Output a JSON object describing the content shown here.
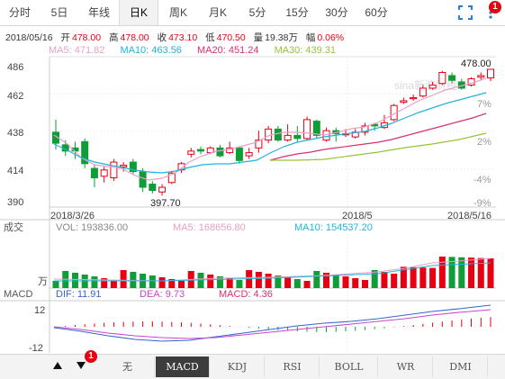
{
  "tabs": [
    {
      "label": "分时"
    },
    {
      "label": "5日"
    },
    {
      "label": "年线"
    },
    {
      "label": "日K"
    },
    {
      "label": "周K"
    },
    {
      "label": "月K"
    },
    {
      "label": "5分"
    },
    {
      "label": "15分"
    },
    {
      "label": "30分"
    },
    {
      "label": "60分"
    }
  ],
  "notification_count": "1",
  "quote": {
    "date": "2018/05/16",
    "open_label": "开",
    "open": "478.00",
    "high_label": "高",
    "high": "478.00",
    "close_label": "收",
    "close": "473.10",
    "low_label": "低",
    "low": "470.50",
    "vol_label": "量",
    "vol": "19.38万",
    "amp_label": "幅",
    "amp": "0.06%"
  },
  "ma": {
    "ma5": "MA5: 471.82",
    "ma10": "MA10: 463.56",
    "ma20": "MA20: 451.24",
    "ma30": "MA30: 439.31"
  },
  "watermark": "sina新浪财经",
  "price_axis": [
    "486",
    "462",
    "438",
    "414",
    "390"
  ],
  "pct_axis": [
    "7%",
    "2%",
    "-4%",
    "-9%"
  ],
  "date_axis": [
    "2018/3/26",
    "2018/5",
    "2018/5/16"
  ],
  "price_high_label": "478.00",
  "price_low_label": "397.70",
  "volume": {
    "title": "成交",
    "vol": "VOL: 193836.00",
    "ma5": "MA5: 168656.80",
    "ma10": "MA10: 154537.20",
    "unit": "万"
  },
  "macd": {
    "title": "MACD",
    "dif": "DIF: 11.91",
    "dea": "DEA: 9.73",
    "macd": "MACD: 4.36",
    "axis_top": "12",
    "axis_bottom": "-12"
  },
  "bottom_tabs": [
    "无",
    "MACD",
    "KDJ",
    "RSI",
    "BOLL",
    "WR",
    "DMI"
  ],
  "bottom_badge": "1",
  "colors": {
    "up": "#e60012",
    "down": "#0f9d37",
    "ma5": "#e8a0c8",
    "ma10": "#23b3d9",
    "ma20": "#d93070",
    "ma30": "#99c23a",
    "dif": "#3366cc",
    "dea": "#cc44cc"
  },
  "chart_data": {
    "type": "candlestick",
    "ylim": [
      390,
      486
    ],
    "candles": [
      {
        "o": 438,
        "c": 431,
        "h": 446,
        "l": 427
      },
      {
        "o": 430,
        "c": 426,
        "h": 433,
        "l": 423
      },
      {
        "o": 428,
        "c": 426,
        "h": 432,
        "l": 421
      },
      {
        "o": 432,
        "c": 418,
        "h": 434,
        "l": 415
      },
      {
        "o": 415,
        "c": 409,
        "h": 417,
        "l": 403
      },
      {
        "o": 410,
        "c": 414,
        "h": 416,
        "l": 406
      },
      {
        "o": 409,
        "c": 419,
        "h": 421,
        "l": 407
      },
      {
        "o": 416,
        "c": 417,
        "h": 419,
        "l": 413
      },
      {
        "o": 419,
        "c": 413,
        "h": 421,
        "l": 411
      },
      {
        "o": 413,
        "c": 403,
        "h": 415,
        "l": 400
      },
      {
        "o": 405,
        "c": 401,
        "h": 407,
        "l": 399
      },
      {
        "o": 400,
        "c": 403,
        "h": 405,
        "l": 397.7
      },
      {
        "o": 406,
        "c": 412,
        "h": 413,
        "l": 405
      },
      {
        "o": 414,
        "c": 418,
        "h": 419,
        "l": 412
      },
      {
        "o": 424,
        "c": 426,
        "h": 428,
        "l": 422
      },
      {
        "o": 427,
        "c": 426,
        "h": 429,
        "l": 424
      },
      {
        "o": 425,
        "c": 428,
        "h": 429,
        "l": 424
      },
      {
        "o": 428,
        "c": 423,
        "h": 430,
        "l": 422
      },
      {
        "o": 425,
        "c": 428,
        "h": 432,
        "l": 424
      },
      {
        "o": 428,
        "c": 420,
        "h": 429,
        "l": 418
      },
      {
        "o": 423,
        "c": 425,
        "h": 428,
        "l": 421
      },
      {
        "o": 428,
        "c": 433,
        "h": 439,
        "l": 425
      },
      {
        "o": 433,
        "c": 440,
        "h": 442,
        "l": 431
      },
      {
        "o": 440,
        "c": 433,
        "h": 442,
        "l": 432
      },
      {
        "o": 433,
        "c": 436,
        "h": 443,
        "l": 432
      },
      {
        "o": 436,
        "c": 434,
        "h": 442,
        "l": 432
      },
      {
        "o": 434,
        "c": 446,
        "h": 448,
        "l": 433
      },
      {
        "o": 445,
        "c": 436,
        "h": 446,
        "l": 434
      },
      {
        "o": 433,
        "c": 439,
        "h": 441,
        "l": 432
      },
      {
        "o": 439,
        "c": 437,
        "h": 441,
        "l": 432
      },
      {
        "o": 437,
        "c": 437,
        "h": 440,
        "l": 435
      },
      {
        "o": 435,
        "c": 438,
        "h": 440,
        "l": 434
      },
      {
        "o": 438,
        "c": 442,
        "h": 444,
        "l": 436
      },
      {
        "o": 443,
        "c": 442,
        "h": 444,
        "l": 439
      },
      {
        "o": 441,
        "c": 444,
        "h": 449,
        "l": 440
      },
      {
        "o": 446,
        "c": 455,
        "h": 456,
        "l": 445
      },
      {
        "o": 457,
        "c": 458,
        "h": 460,
        "l": 456
      },
      {
        "o": 460,
        "c": 460,
        "h": 462,
        "l": 458
      },
      {
        "o": 461,
        "c": 466,
        "h": 468,
        "l": 460
      },
      {
        "o": 466,
        "c": 468,
        "h": 470,
        "l": 465
      },
      {
        "o": 469,
        "c": 476,
        "h": 477,
        "l": 468
      },
      {
        "o": 474,
        "c": 471,
        "h": 476,
        "l": 469
      },
      {
        "o": 470,
        "c": 466,
        "h": 472,
        "l": 465
      },
      {
        "o": 468,
        "c": 472,
        "h": 473,
        "l": 467
      },
      {
        "o": 473,
        "c": 474,
        "h": 476,
        "l": 471
      },
      {
        "o": 472.5,
        "c": 478,
        "h": 478,
        "l": 470.5
      }
    ]
  }
}
